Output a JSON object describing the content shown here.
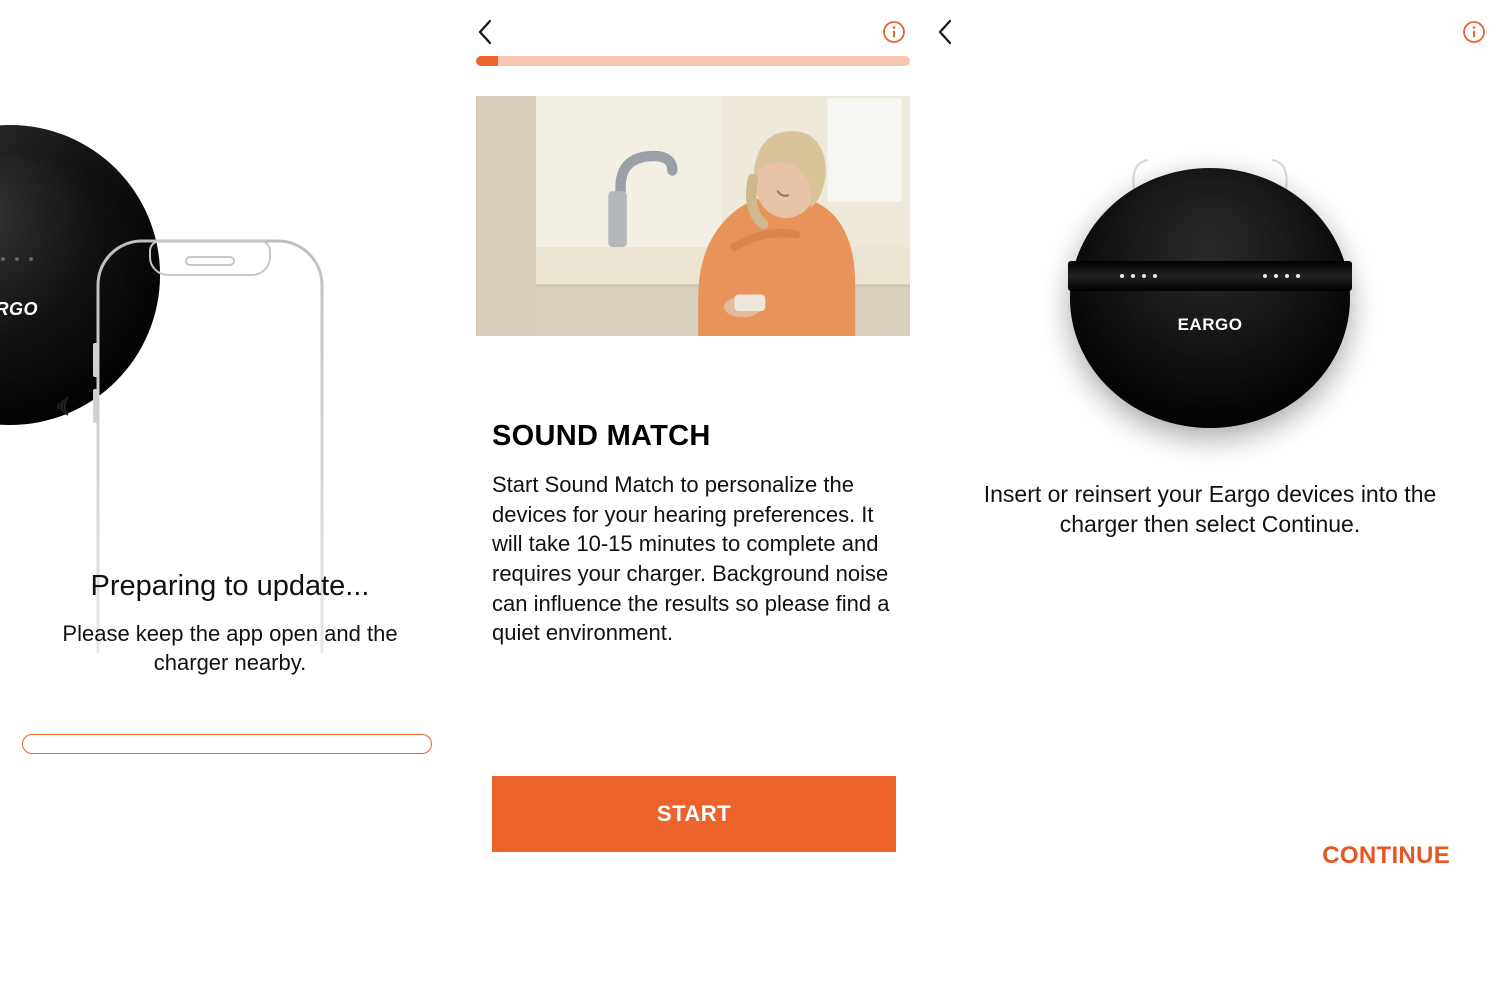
{
  "colors": {
    "accent": "#EC632C",
    "accent_light": "#F8C6B0",
    "ink": "#000000"
  },
  "panel1": {
    "device_logo": "ARGO",
    "title": "Preparing to update...",
    "body": "Please keep the app open and the charger nearby."
  },
  "panel2": {
    "progress_percent": 5,
    "heading": "SOUND MATCH",
    "body": "Start Sound Match to personalize the devices for your hearing preferences. It will take 10-15 minutes to complete and requires your charger. Background noise can influence the results so please find a quiet environment.",
    "button_label": "START"
  },
  "panel3": {
    "device_logo": "EARGO",
    "body": "Insert or reinsert your Eargo devices into the charger then select Continue.",
    "continue_label": "CONTINUE"
  }
}
